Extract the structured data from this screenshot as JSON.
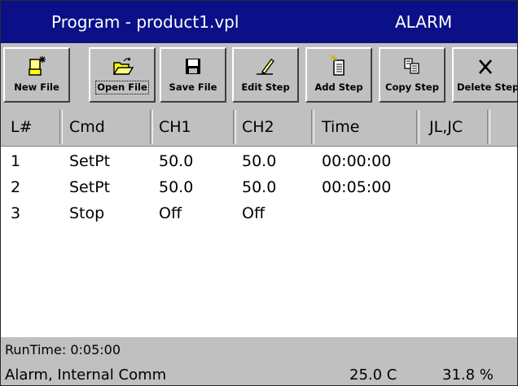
{
  "titlebar": {
    "title": "Program - product1.vpl",
    "status": "ALARM"
  },
  "toolbar": {
    "buttons": [
      {
        "label": "New File",
        "icon": "new-file-icon"
      },
      {
        "label": "Open File",
        "icon": "open-folder-icon",
        "focused": true
      },
      {
        "label": "Save File",
        "icon": "floppy-disk-icon"
      },
      {
        "label": "Edit Step",
        "icon": "pencil-icon"
      },
      {
        "label": "Add Step",
        "icon": "add-document-icon"
      },
      {
        "label": "Copy Step",
        "icon": "copy-icon"
      },
      {
        "label": "Delete Step",
        "icon": "delete-x-icon"
      }
    ]
  },
  "table": {
    "headers": [
      "L#",
      "Cmd",
      "CH1",
      "CH2",
      "Time",
      "JL,JC"
    ],
    "rows": [
      [
        "1",
        "SetPt",
        "50.0",
        "50.0",
        "00:00:00",
        ""
      ],
      [
        "2",
        "SetPt",
        "50.0",
        "50.0",
        "00:05:00",
        ""
      ],
      [
        "3",
        "Stop",
        "Off",
        "Off",
        "",
        ""
      ]
    ]
  },
  "statusbar": {
    "runtime": "RunTime: 0:05:00",
    "alarm": "Alarm, Internal Comm",
    "temperature": "25.0 C",
    "humidity": "31.8 %"
  },
  "colors": {
    "titlebar": "#0b1088",
    "panel": "#c0c0c0"
  }
}
